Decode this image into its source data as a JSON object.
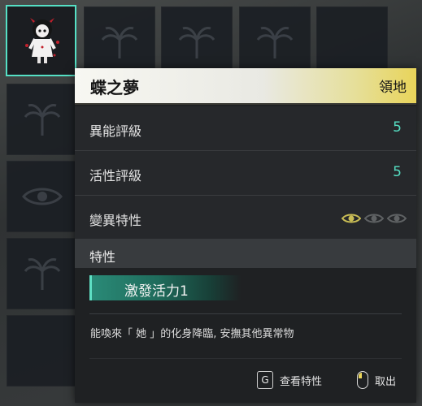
{
  "item": {
    "name": "蝶之夢",
    "category": "領地"
  },
  "stats": [
    {
      "label": "異能評級",
      "value": "5"
    },
    {
      "label": "活性評級",
      "value": "5"
    }
  ],
  "mutation": {
    "label": "變異特性",
    "levels_total": 3,
    "levels_active": 1
  },
  "traits": {
    "header": "特性",
    "items": [
      "激發活力1"
    ]
  },
  "description": "能喚來「 她 」的化身降臨, 安撫其他異常物",
  "actions": [
    {
      "key": "G",
      "label": "查看特性",
      "icon": "keyboard-key"
    },
    {
      "key": "",
      "label": "取出",
      "icon": "mouse-left-click-icon"
    }
  ],
  "colors": {
    "accent": "#55e0c5",
    "value": "#56e0c4",
    "header_gold": "#e8d45a",
    "eye_active": "#c9bd55",
    "eye_inactive": "#5f6264"
  }
}
